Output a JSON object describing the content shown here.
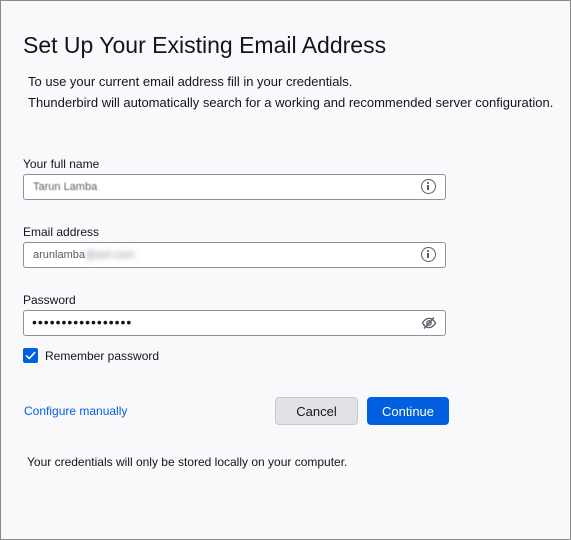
{
  "dialog": {
    "title": "Set Up Your Existing Email Address",
    "intro_line1": "To use your current email address fill in your credentials.",
    "intro_line2": "Thunderbird will automatically search for a working and recommended server configuration."
  },
  "form": {
    "full_name": {
      "label": "Your full name",
      "value": "Tarun Lamba",
      "icon": "info-icon"
    },
    "email": {
      "label": "Email address",
      "value_visible": "arunlamba",
      "value_obscured": "@aol.com",
      "icon": "info-icon"
    },
    "password": {
      "label": "Password",
      "masked_value": "•••••••••••••••••",
      "icon": "eye-slash-icon"
    },
    "remember_password": {
      "label": "Remember password",
      "checked": true
    }
  },
  "actions": {
    "configure_manually": "Configure manually",
    "cancel": "Cancel",
    "continue": "Continue"
  },
  "footer": {
    "note": "Your credentials will only be stored locally on your computer."
  },
  "colors": {
    "accent": "#0060df",
    "background": "#f9f9fb",
    "text": "#15141a"
  }
}
